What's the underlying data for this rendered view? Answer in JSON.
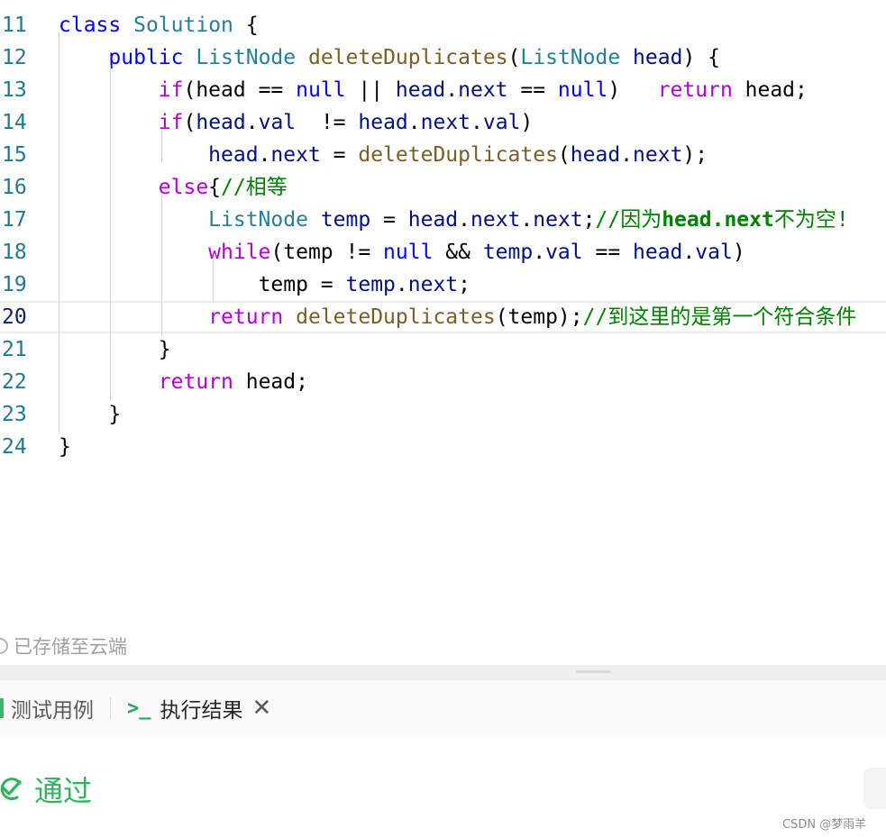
{
  "editor": {
    "lines": [
      {
        "num": "11",
        "indent": "",
        "tokens": [
          {
            "t": "class",
            "c": "kw"
          },
          {
            "t": " "
          },
          {
            "t": "Solution",
            "c": "type"
          },
          {
            "t": " {"
          }
        ]
      },
      {
        "num": "12",
        "indent": "    ",
        "tokens": [
          {
            "t": "public",
            "c": "kw"
          },
          {
            "t": " "
          },
          {
            "t": "ListNode",
            "c": "type"
          },
          {
            "t": " "
          },
          {
            "t": "deleteDuplicates",
            "c": "fn"
          },
          {
            "t": "("
          },
          {
            "t": "ListNode",
            "c": "type"
          },
          {
            "t": " "
          },
          {
            "t": "head",
            "c": "var"
          },
          {
            "t": ") {"
          }
        ]
      },
      {
        "num": "13",
        "indent": "        ",
        "tokens": [
          {
            "t": "if",
            "c": "ctl"
          },
          {
            "t": "(head == "
          },
          {
            "t": "null",
            "c": "kw"
          },
          {
            "t": " || "
          },
          {
            "t": "head",
            "c": "var"
          },
          {
            "t": "."
          },
          {
            "t": "next",
            "c": "var"
          },
          {
            "t": " == "
          },
          {
            "t": "null",
            "c": "kw"
          },
          {
            "t": ")   "
          },
          {
            "t": "return",
            "c": "ctl"
          },
          {
            "t": " head;"
          }
        ]
      },
      {
        "num": "14",
        "indent": "        ",
        "tokens": [
          {
            "t": "if",
            "c": "ctl"
          },
          {
            "t": "("
          },
          {
            "t": "head",
            "c": "var"
          },
          {
            "t": "."
          },
          {
            "t": "val",
            "c": "var"
          },
          {
            "t": "  != "
          },
          {
            "t": "head",
            "c": "var"
          },
          {
            "t": "."
          },
          {
            "t": "next",
            "c": "var"
          },
          {
            "t": "."
          },
          {
            "t": "val",
            "c": "var"
          },
          {
            "t": ")"
          }
        ]
      },
      {
        "num": "15",
        "indent": "            ",
        "tokens": [
          {
            "t": "head",
            "c": "var"
          },
          {
            "t": "."
          },
          {
            "t": "next",
            "c": "var"
          },
          {
            "t": " = "
          },
          {
            "t": "deleteDuplicates",
            "c": "fn"
          },
          {
            "t": "("
          },
          {
            "t": "head",
            "c": "var"
          },
          {
            "t": "."
          },
          {
            "t": "next",
            "c": "var"
          },
          {
            "t": ");"
          }
        ]
      },
      {
        "num": "16",
        "indent": "        ",
        "tokens": [
          {
            "t": "else",
            "c": "ctl"
          },
          {
            "t": "{"
          },
          {
            "t": "//相等",
            "c": "com"
          }
        ]
      },
      {
        "num": "17",
        "indent": "            ",
        "tokens": [
          {
            "t": "ListNode",
            "c": "type"
          },
          {
            "t": " "
          },
          {
            "t": "temp",
            "c": "var"
          },
          {
            "t": " = "
          },
          {
            "t": "head",
            "c": "var"
          },
          {
            "t": "."
          },
          {
            "t": "next",
            "c": "var"
          },
          {
            "t": "."
          },
          {
            "t": "next",
            "c": "var"
          },
          {
            "t": ";"
          },
          {
            "t": "//因为",
            "c": "com"
          },
          {
            "t": "head.next",
            "c": "com-bold"
          },
          {
            "t": "不为空!",
            "c": "com"
          }
        ]
      },
      {
        "num": "18",
        "indent": "            ",
        "tokens": [
          {
            "t": "while",
            "c": "ctl"
          },
          {
            "t": "(temp != "
          },
          {
            "t": "null",
            "c": "kw"
          },
          {
            "t": " && "
          },
          {
            "t": "temp",
            "c": "var"
          },
          {
            "t": "."
          },
          {
            "t": "val",
            "c": "var"
          },
          {
            "t": " == "
          },
          {
            "t": "head",
            "c": "var"
          },
          {
            "t": "."
          },
          {
            "t": "val",
            "c": "var"
          },
          {
            "t": ")"
          }
        ]
      },
      {
        "num": "19",
        "indent": "                ",
        "tokens": [
          {
            "t": "temp = "
          },
          {
            "t": "temp",
            "c": "var"
          },
          {
            "t": "."
          },
          {
            "t": "next",
            "c": "var"
          },
          {
            "t": ";"
          }
        ]
      },
      {
        "num": "20",
        "indent": "            ",
        "active": true,
        "tokens": [
          {
            "t": "return",
            "c": "ctl"
          },
          {
            "t": " "
          },
          {
            "t": "deleteDuplicates",
            "c": "fn"
          },
          {
            "t": "(temp);"
          },
          {
            "t": "//到这里的是第一个符合条件",
            "c": "com"
          }
        ]
      },
      {
        "num": "21",
        "indent": "        ",
        "tokens": [
          {
            "t": "}"
          }
        ]
      },
      {
        "num": "22",
        "indent": "        ",
        "tokens": [
          {
            "t": "return",
            "c": "ctl"
          },
          {
            "t": " head;"
          }
        ]
      },
      {
        "num": "23",
        "indent": "    ",
        "tokens": [
          {
            "t": "}"
          }
        ]
      },
      {
        "num": "24",
        "indent": "",
        "tokens": [
          {
            "t": "}"
          }
        ]
      }
    ]
  },
  "status": {
    "saved_text": "已存储至云端"
  },
  "panel": {
    "tabs": {
      "test_cases": "测试用例",
      "result": "执行结果",
      "prompt_glyph": ">_",
      "close_glyph": "✕"
    },
    "result_text": "通过"
  },
  "watermark": "CSDN @梦雨羊",
  "colors": {
    "success": "#2db55d",
    "line_number": "#237893",
    "comment": "#008000"
  }
}
